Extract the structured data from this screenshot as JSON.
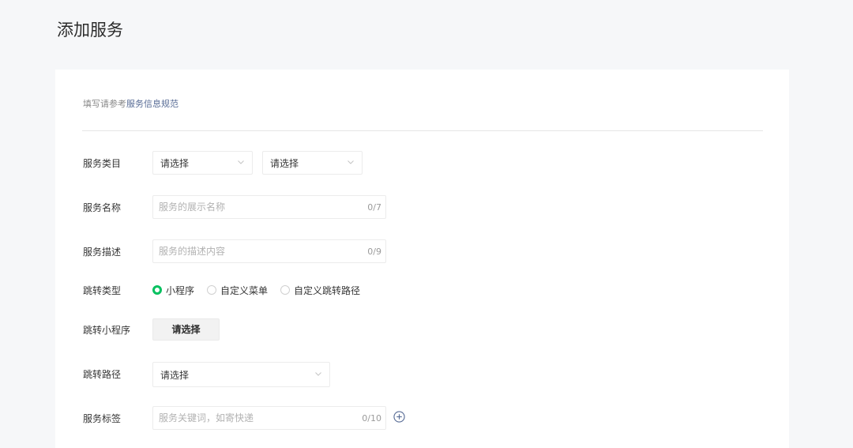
{
  "page": {
    "title": "添加服务"
  },
  "notice": {
    "prefix": "填写请参考",
    "link": "服务信息规范"
  },
  "form": {
    "category": {
      "label": "服务类目",
      "select1": "请选择",
      "select2": "请选择"
    },
    "name": {
      "label": "服务名称",
      "placeholder": "服务的展示名称",
      "count": "0/7"
    },
    "description": {
      "label": "服务描述",
      "placeholder": "服务的描述内容",
      "count": "0/9"
    },
    "jump_type": {
      "label": "跳转类型",
      "options": [
        "小程序",
        "自定义菜单",
        "自定义跳转路径"
      ],
      "selected": "小程序"
    },
    "mini_program": {
      "label": "跳转小程序",
      "button": "请选择"
    },
    "path": {
      "label": "跳转路径",
      "select": "请选择"
    },
    "tags": {
      "label": "服务标签",
      "placeholder": "服务关键词，如寄快递",
      "count": "0/10"
    }
  },
  "colors": {
    "accent_green": "#07c160",
    "link_blue": "#576b95"
  },
  "icons": {
    "chevron": "chevron-down-icon",
    "add": "plus-circle-icon"
  }
}
